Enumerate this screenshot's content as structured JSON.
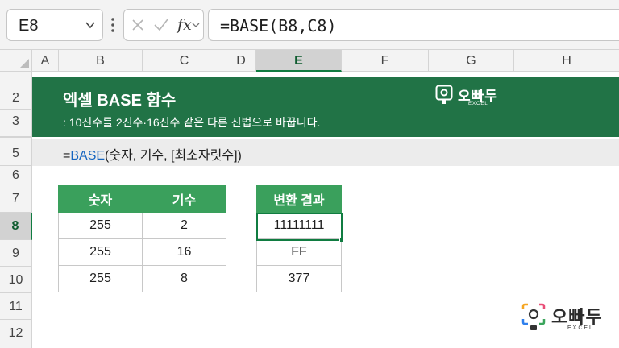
{
  "formula_bar": {
    "name_box": "E8",
    "fx_label": "fx",
    "formula": "=BASE(B8,C8)"
  },
  "columns": [
    "A",
    "B",
    "C",
    "D",
    "E",
    "F",
    "G",
    "H"
  ],
  "selected_column": "E",
  "rows": [
    "2",
    "3",
    "5",
    "6",
    "7",
    "8",
    "9",
    "10",
    "11",
    "12"
  ],
  "selected_row": "8",
  "banner": {
    "title": "엑셀 BASE 함수",
    "subtitle": ": 10진수를 2진수·16진수 같은 다른 진법으로 바꿉니다."
  },
  "syntax": {
    "prefix": "=",
    "function_name": "BASE",
    "args": "(숫자, 기수, [최소자릿수])"
  },
  "input_table": {
    "headers": [
      "숫자",
      "기수"
    ],
    "rows": [
      [
        "255",
        "2"
      ],
      [
        "255",
        "16"
      ],
      [
        "255",
        "8"
      ]
    ]
  },
  "result_table": {
    "header": "변환 결과",
    "values": [
      "11111111",
      "FF",
      "377"
    ]
  },
  "brand": {
    "name": "오빠두",
    "tagline": "EXCEL"
  },
  "colors": {
    "banner": "#217346",
    "header_green": "#3aa05c",
    "selection": "#107c41",
    "function_blue": "#1565c0"
  }
}
